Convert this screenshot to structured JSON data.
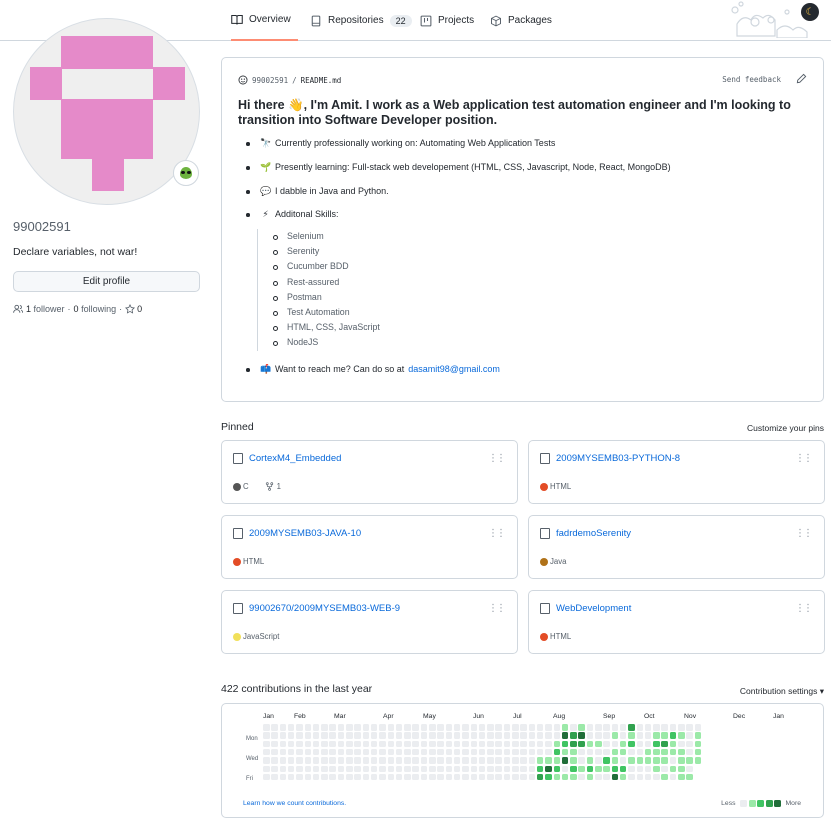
{
  "tabs": [
    {
      "label": "Overview",
      "selected": true,
      "icon": "book-icon"
    },
    {
      "label": "Repositories",
      "count": "22",
      "icon": "repo-icon"
    },
    {
      "label": "Projects",
      "icon": "project-icon"
    },
    {
      "label": "Packages",
      "icon": "package-icon"
    }
  ],
  "profile": {
    "username": "99002591",
    "bio": "Declare variables, not war!",
    "edit_label": "Edit profile",
    "followers": "1",
    "followers_label": "follower",
    "following": "0",
    "following_label": "following",
    "stars": "0",
    "status_emoji": "alien-icon"
  },
  "readme": {
    "path_user": "99002591",
    "path_sep": "/",
    "path_file": "README.md",
    "send_feedback": "Send feedback",
    "title": "Hi there 👋, I'm Amit. I work as a Web application test automation engineer and I'm looking to transition into Software Developer position.",
    "items": [
      {
        "emoji": "🔭",
        "text": "Currently professionally working on: Automating Web Application Tests"
      },
      {
        "emoji": "🌱",
        "text": "Presently learning: Full-stack web developement (HTML, CSS, Javascript, Node, React, MongoDB)"
      },
      {
        "emoji": "💬",
        "text": "I dabble in Java and Python."
      },
      {
        "emoji": "⚡",
        "text": "Additonal Skills:"
      }
    ],
    "skills": [
      "Selenium",
      "Serenity",
      "Cucumber BDD",
      "Rest-assured",
      "Postman",
      "Test Automation",
      "HTML, CSS, JavaScript",
      "NodeJS"
    ],
    "contact_emoji": "📫",
    "contact_text": "Want to reach me? Can do so at",
    "contact_email": "dasamit98@gmail.com"
  },
  "pinned": {
    "label": "Pinned",
    "customize": "Customize your pins",
    "repos": [
      {
        "name": "CortexM4_Embedded",
        "lang": "C",
        "color": "#555555",
        "forks": "1"
      },
      {
        "name": "2009MYSEMB03-PYTHON-8",
        "lang": "HTML",
        "color": "#e34c26"
      },
      {
        "name": "2009MYSEMB03-JAVA-10",
        "lang": "HTML",
        "color": "#e34c26"
      },
      {
        "name": "fadrdemoSerenity",
        "lang": "Java",
        "color": "#b07219"
      },
      {
        "name": "99002670/2009MYSEMB03-WEB-9",
        "lang": "JavaScript",
        "color": "#f1e05a"
      },
      {
        "name": "WebDevelopment",
        "lang": "HTML",
        "color": "#e34c26"
      }
    ]
  },
  "contributions": {
    "summary": "422 contributions in the last year",
    "settings": "Contribution settings ▾",
    "months": [
      "Jan",
      "Feb",
      "Mar",
      "Apr",
      "May",
      "Jun",
      "Jul",
      "Aug",
      "Sep",
      "Oct",
      "Nov",
      "Dec",
      "Jan"
    ],
    "days": [
      "Mon",
      "Wed",
      "Fri"
    ],
    "learn": "Learn how we count contributions.",
    "less": "Less",
    "more": "More",
    "colors": [
      "#ebedf0",
      "#9be9a8",
      "#40c463",
      "#30a14e",
      "#216e39"
    ],
    "active_weeks": [
      [
        0,
        0,
        0,
        0,
        0,
        0,
        0
      ],
      [
        0,
        0,
        0,
        0,
        1,
        2,
        3
      ],
      [
        0,
        0,
        0,
        0,
        1,
        4,
        2
      ],
      [
        0,
        0,
        1,
        2,
        1,
        2,
        1
      ],
      [
        1,
        4,
        2,
        1,
        4,
        0,
        1
      ],
      [
        0,
        3,
        3,
        1,
        1,
        2,
        1
      ],
      [
        1,
        4,
        3,
        0,
        0,
        1,
        0
      ],
      [
        0,
        0,
        1,
        0,
        1,
        2,
        1
      ],
      [
        0,
        0,
        1,
        0,
        0,
        1,
        0
      ],
      [
        0,
        0,
        0,
        0,
        2,
        1,
        0
      ],
      [
        0,
        1,
        0,
        1,
        1,
        2,
        4
      ],
      [
        0,
        0,
        1,
        1,
        0,
        2,
        1
      ],
      [
        3,
        1,
        2,
        0,
        1,
        0,
        0
      ],
      [
        0,
        0,
        0,
        0,
        1,
        0,
        0
      ],
      [
        0,
        0,
        0,
        1,
        1,
        0,
        0
      ],
      [
        0,
        1,
        2,
        1,
        1,
        1,
        0
      ],
      [
        0,
        1,
        3,
        1,
        1,
        0,
        1
      ],
      [
        0,
        2,
        1,
        1,
        0,
        1,
        0
      ],
      [
        0,
        1,
        0,
        1,
        1,
        1,
        1
      ],
      [
        0,
        0,
        0,
        0,
        1,
        0,
        1
      ],
      [
        0,
        1,
        1,
        1,
        1,
        1,
        1
      ]
    ]
  }
}
